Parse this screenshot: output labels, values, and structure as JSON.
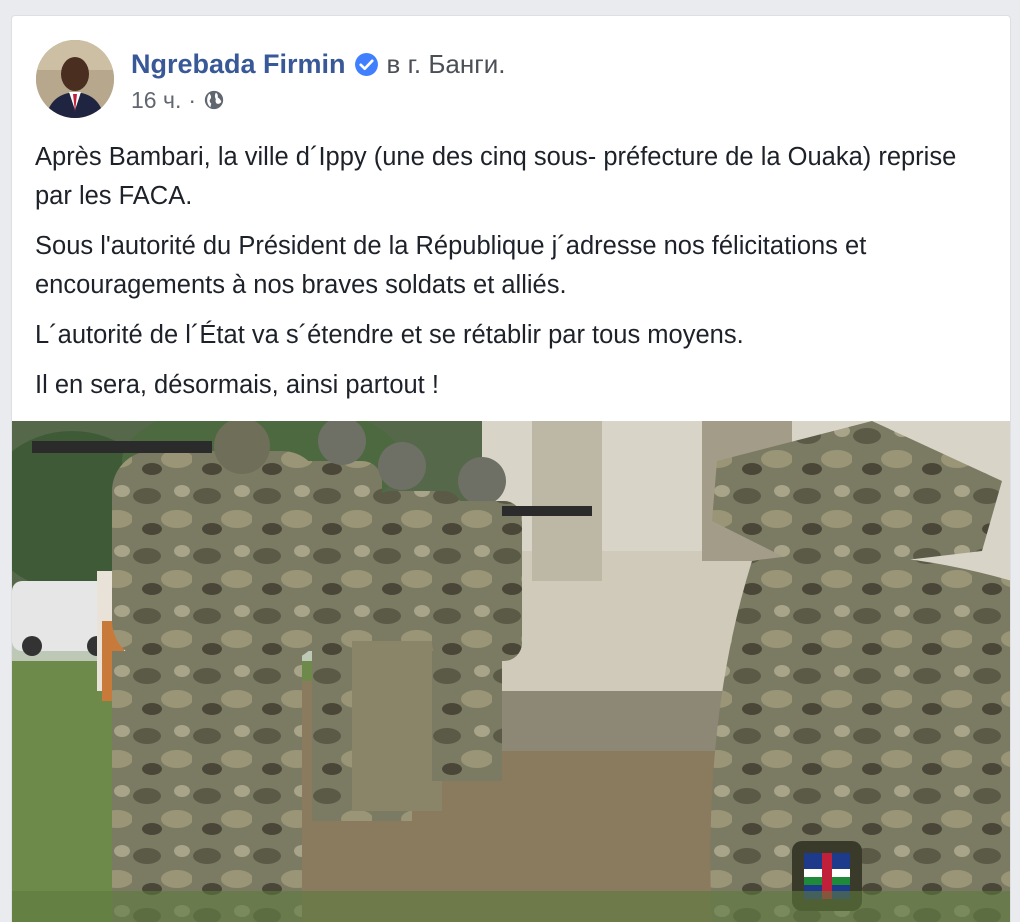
{
  "post": {
    "author_name": "Ngrebada Firmin",
    "location": "в г. Банги.",
    "time": "16 ч.",
    "separator": "·",
    "privacy_icon": "globe-icon",
    "verified_icon": "verified-badge-icon",
    "paragraphs": [
      "Après Bambari, la ville d´Ippy (une des cinq sous- préfecture de la Ouaka) reprise par les FACA.",
      "Sous l'autorité du Président de la République j´adresse nos félicitations et encouragements à nos braves soldats et alliés.",
      "L´autorité de l´État va s´étendre et se rétablir par tous moyens.",
      "Il en sera, désormais, ainsi partout !"
    ]
  },
  "colors": {
    "author": "#385898",
    "verified": "#4080ff",
    "page_bg": "#e9ebee",
    "card_bg": "#ffffff"
  }
}
